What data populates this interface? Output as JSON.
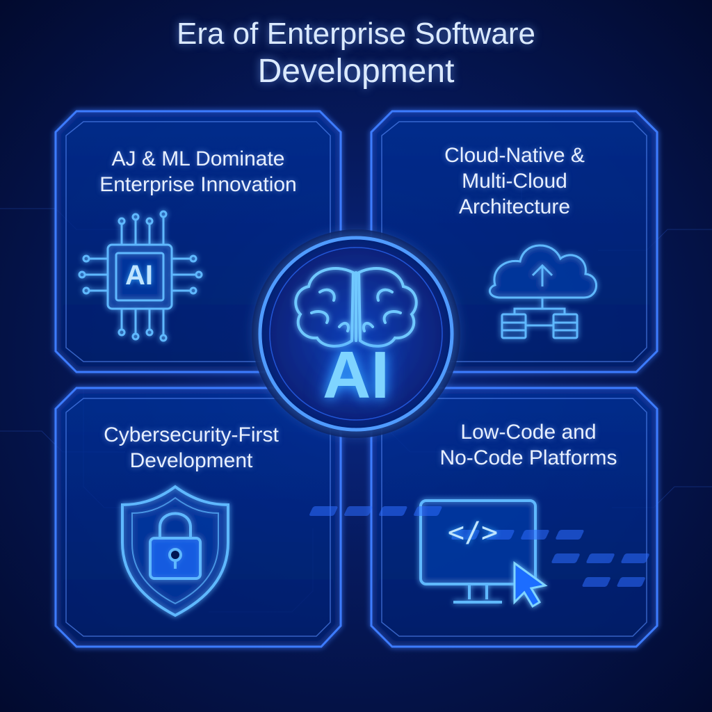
{
  "title": {
    "line1": "Era of Enterprise Software",
    "line2": "Development"
  },
  "hub": {
    "label": "AI",
    "icon": "brain-icon"
  },
  "cards": [
    {
      "id": "ai-ml",
      "title_lines": [
        "AJ & ML Dominate",
        "Enterprise Innovation"
      ],
      "icon": "ai-chip-icon",
      "icon_label": "AI"
    },
    {
      "id": "cloud",
      "title_lines": [
        "Cloud-Native &",
        "Multi-Cloud",
        "Architecture"
      ],
      "icon": "cloud-servers-icon"
    },
    {
      "id": "security",
      "title_lines": [
        "Cybersecurity-First",
        "Development"
      ],
      "icon": "shield-lock-icon"
    },
    {
      "id": "lowcode",
      "title_lines": [
        "Low-Code and",
        "No-Code Platforms"
      ],
      "icon": "monitor-code-icon",
      "icon_label": "</>"
    }
  ],
  "colors": {
    "background": "#061a5e",
    "glow": "#3d7bff",
    "accent": "#7fd4ff",
    "text": "#e8f0ff"
  }
}
